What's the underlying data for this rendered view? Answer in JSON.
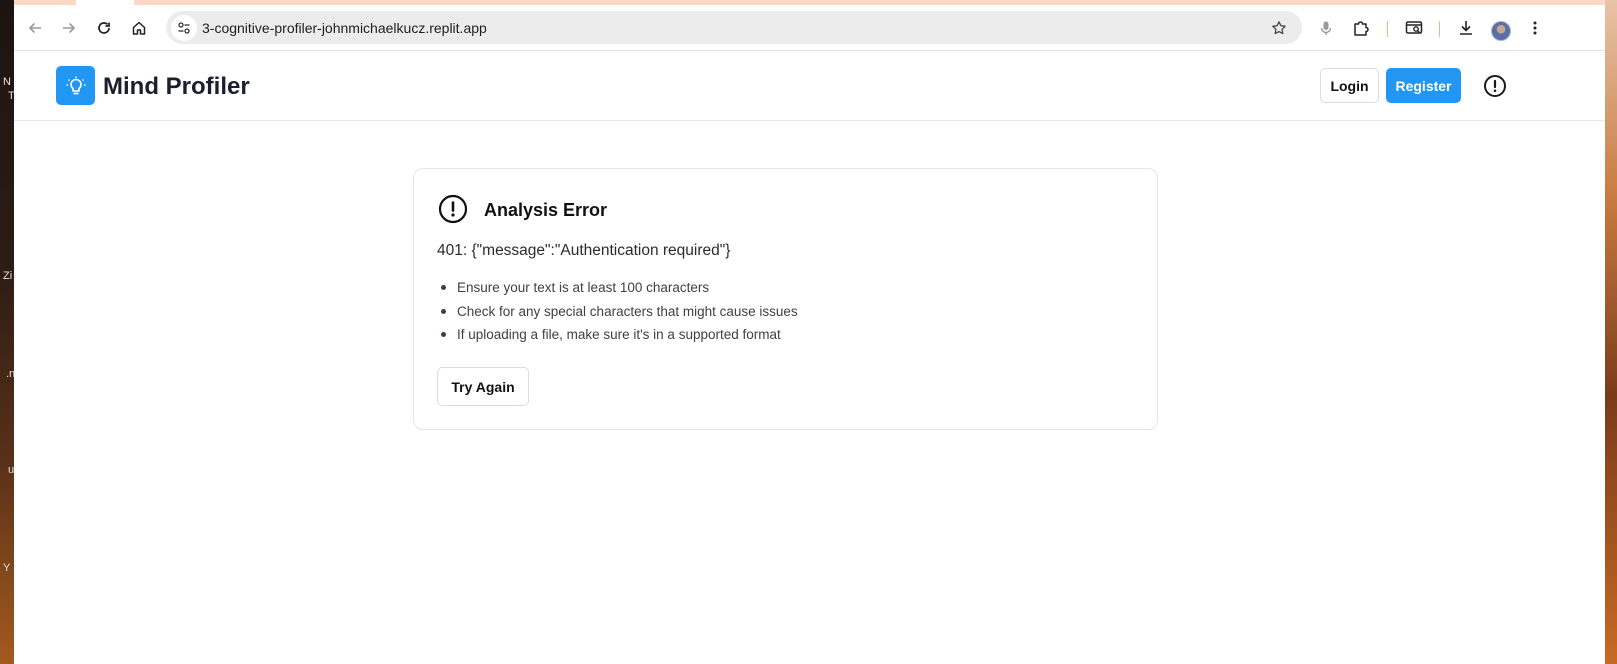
{
  "desktop": {
    "labels": [
      "N",
      "T",
      "Zi",
      ".n",
      "u",
      "Y"
    ]
  },
  "browser": {
    "url": "3-cognitive-profiler-johnmichaelkucz.replit.app"
  },
  "app": {
    "brand": "Mind Profiler",
    "login_label": "Login",
    "register_label": "Register",
    "accent": "#2196f3"
  },
  "error": {
    "title": "Analysis Error",
    "message": "401: {\"message\":\"Authentication required\"}",
    "tips": [
      "Ensure your text is at least 100 characters",
      "Check for any special characters that might cause issues",
      "If uploading a file, make sure it's in a supported format"
    ],
    "retry_label": "Try Again"
  }
}
